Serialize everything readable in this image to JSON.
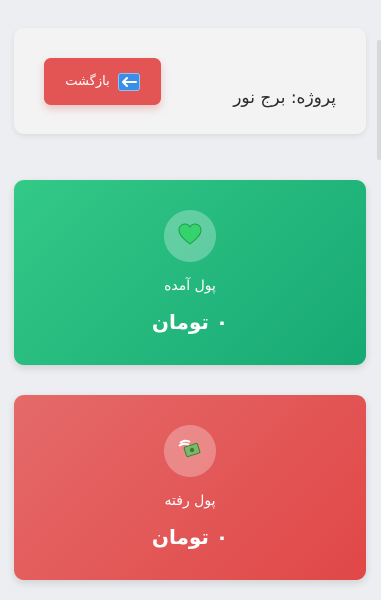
{
  "header": {
    "project_title": "پروژه: برج نور",
    "back_label": "بازگشت",
    "back_icon": "left-arrow-icon"
  },
  "income": {
    "icon": "green-heart-icon",
    "label": "پول آمده",
    "amount": "۰ تومان"
  },
  "expense": {
    "icon": "money-with-wings-icon",
    "label": "پول رفته",
    "amount": "۰ تومان"
  },
  "colors": {
    "income_card": "#1fb97c",
    "expense_card": "#e35454",
    "back_button": "#e35454"
  }
}
